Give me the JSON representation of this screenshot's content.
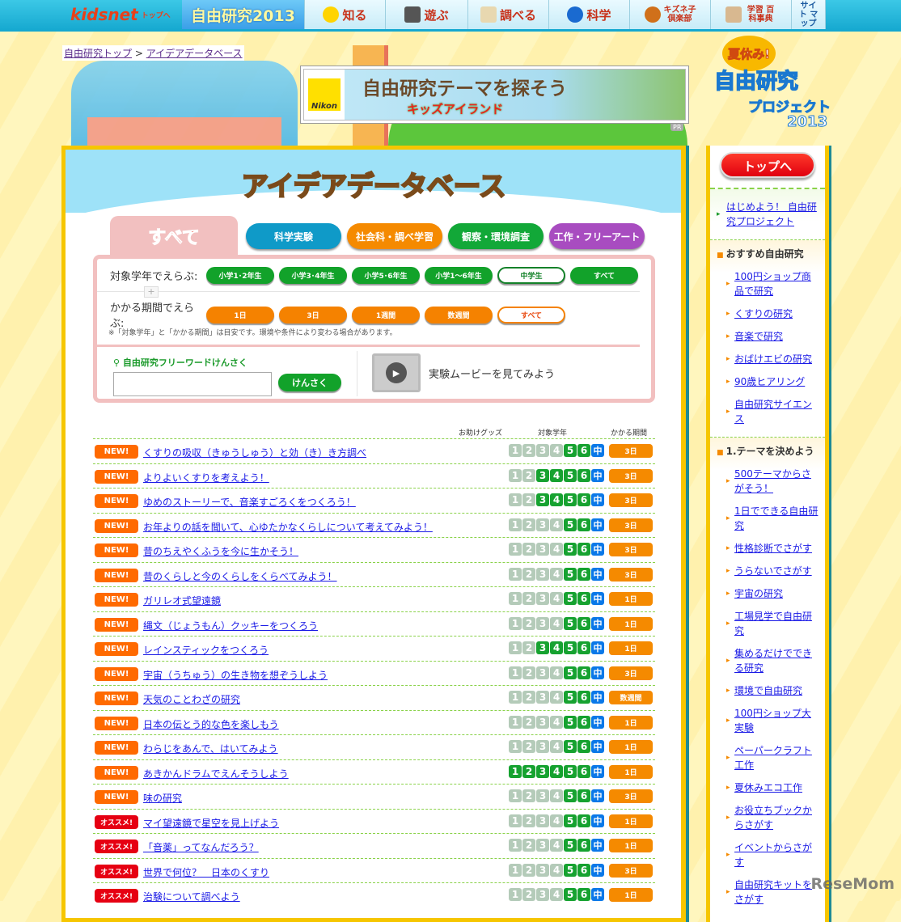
{
  "topnav": {
    "logo": "kidsnet",
    "logo_sub": "トップへ",
    "items": [
      {
        "label": "自由研究2013",
        "icon": "jiyu-kenkyu-logo"
      },
      {
        "label": "知る",
        "icon": "lightbulb-icon"
      },
      {
        "label": "遊ぶ",
        "icon": "dice-icon"
      },
      {
        "label": "調べる",
        "icon": "book-magnifier-icon"
      },
      {
        "label": "科学",
        "icon": "globe-icon"
      },
      {
        "label": "キズネ子 倶楽部",
        "icon": "fox-icon"
      },
      {
        "label": "学習 百科事典",
        "icon": "encyclopedia-icon"
      },
      {
        "label": "サイト マップ",
        "icon": ""
      }
    ]
  },
  "breadcrumb": {
    "home": "自由研究トップ",
    "sep": ">",
    "current": "アイデアデータベース"
  },
  "ad": {
    "brand": "Nikon",
    "headline": "自由研究テーマを探そう",
    "sub": "キッズアイランド",
    "pr": "PR"
  },
  "page_title": "アイデアデータベース",
  "tabs": [
    {
      "label": "すべて",
      "color": "#f2c0c0",
      "active": true
    },
    {
      "label": "科学実験",
      "color": "#0f9ac8"
    },
    {
      "label": "社会科・調べ学習",
      "color": "#f58a00"
    },
    {
      "label": "観察・環境調査",
      "color": "#12a838"
    },
    {
      "label": "工作・フリーアート",
      "color": "#a84cc0"
    }
  ],
  "filter": {
    "grade_label": "対象学年でえらぶ:",
    "grade_options": [
      "小学1･2年生",
      "小学3･4年生",
      "小学5･6年生",
      "小学1〜6年生",
      "中学生",
      "すべて"
    ],
    "grade_selected": "中学生",
    "period_label": "かかる期間でえらぶ:",
    "period_options": [
      "1日",
      "3日",
      "1週間",
      "数週間",
      "すべて"
    ],
    "period_selected": "すべて",
    "plus": "+",
    "note": "※「対象学年」と「かかる期間」は目安です。環境や条件により変わる場合があります。",
    "search_label": "自由研究フリーワードけんさく",
    "search_value": "",
    "search_button": "けんさく",
    "movie_label": "実験ムービーを見てみよう"
  },
  "list": {
    "headers": {
      "goods": "お助けグッズ",
      "grade": "対象学年",
      "period": "かかる期間"
    },
    "grade_labels": [
      "1",
      "2",
      "3",
      "4",
      "5",
      "6",
      "中"
    ],
    "rows": [
      {
        "badge": "NEW!",
        "type": "new",
        "title": "くすりの吸収（きゅうしゅう）と効（き）き方調べ",
        "grades": [
          5,
          6
        ],
        "period": "3日"
      },
      {
        "badge": "NEW!",
        "type": "new",
        "title": "よりよいくすりを考えよう！",
        "grades": [
          3,
          4,
          5,
          6
        ],
        "period": "3日"
      },
      {
        "badge": "NEW!",
        "type": "new",
        "title": "ゆめのストーリーで、音楽すごろくをつくろう！",
        "grades": [
          3,
          4,
          5,
          6
        ],
        "period": "3日"
      },
      {
        "badge": "NEW!",
        "type": "new",
        "title": "お年よりの話を聞いて、心ゆたかなくらしについて考えてみよう！",
        "grades": [
          5,
          6
        ],
        "period": "3日"
      },
      {
        "badge": "NEW!",
        "type": "new",
        "title": "昔のちえやくふうを今に生かそう！",
        "grades": [
          5,
          6
        ],
        "period": "3日"
      },
      {
        "badge": "NEW!",
        "type": "new",
        "title": "昔のくらしと今のくらしをくらべてみよう！",
        "grades": [
          5,
          6
        ],
        "period": "3日"
      },
      {
        "badge": "NEW!",
        "type": "new",
        "title": "ガリレオ式望遠鏡",
        "grades": [
          5,
          6
        ],
        "period": "1日"
      },
      {
        "badge": "NEW!",
        "type": "new",
        "title": "縄文（じょうもん）クッキーをつくろう",
        "grades": [
          5,
          6
        ],
        "period": "1日"
      },
      {
        "badge": "NEW!",
        "type": "new",
        "title": "レインスティックをつくろう",
        "grades": [
          3,
          4,
          5,
          6
        ],
        "period": "1日"
      },
      {
        "badge": "NEW!",
        "type": "new",
        "title": "宇宙（うちゅう）の生き物を想ぞうしよう",
        "grades": [
          5,
          6
        ],
        "period": "3日"
      },
      {
        "badge": "NEW!",
        "type": "new",
        "title": "天気のことわざの研究",
        "grades": [
          5,
          6
        ],
        "period": "数週間"
      },
      {
        "badge": "NEW!",
        "type": "new",
        "title": "日本の伝とう的な色を楽しもう",
        "grades": [
          5,
          6
        ],
        "period": "1日"
      },
      {
        "badge": "NEW!",
        "type": "new",
        "title": "わらじをあんで、はいてみよう",
        "grades": [
          5,
          6
        ],
        "period": "1日"
      },
      {
        "badge": "NEW!",
        "type": "new",
        "title": "あきかんドラムでえんそうしよう",
        "grades": [
          1,
          2,
          3,
          4,
          5,
          6
        ],
        "period": "1日"
      },
      {
        "badge": "NEW!",
        "type": "new",
        "title": "味の研究",
        "grades": [
          5,
          6
        ],
        "period": "3日"
      },
      {
        "badge": "オススメ!",
        "type": "rec",
        "title": "マイ望遠鏡で星空を見上げよう",
        "grades": [
          5,
          6
        ],
        "period": "1日"
      },
      {
        "badge": "オススメ!",
        "type": "rec",
        "title": "「音薬」ってなんだろう？",
        "grades": [
          5,
          6
        ],
        "period": "1日"
      },
      {
        "badge": "オススメ!",
        "type": "rec",
        "title": "世界で何位？　日本のくすり",
        "grades": [
          5,
          6
        ],
        "period": "3日"
      },
      {
        "badge": "オススメ!",
        "type": "rec",
        "title": "治験について調べよう",
        "grades": [
          5,
          6
        ],
        "period": "1日"
      }
    ]
  },
  "sidebar": {
    "natsu": "夏休み!",
    "project": "自由研究",
    "project2": "プロジェクト",
    "year": "2013",
    "top_button": "トップへ",
    "first_link": "はじめよう！ 自由研究プロジェクト",
    "groups": [
      {
        "title": "おすすめ自由研究",
        "links": [
          "100円ショップ商品で研究",
          "くすりの研究",
          "音楽で研究",
          "おばけエビの研究",
          "90歳ヒアリング",
          "自由研究サイエンス"
        ]
      },
      {
        "title": "1.テーマを決めよう",
        "links": [
          "500テーマからさがそう！",
          "1日でできる自由研究",
          "性格診断でさがす",
          "うらないでさがす",
          "宇宙の研究",
          "工場見学で自由研究",
          "集めるだけでできる研究",
          "環境で自由研究",
          "100円ショップ大実験",
          "ペーパークラフト工作",
          "夏休みエコ工作",
          "お役立ちブックからさがす",
          "イベントからさがす",
          "自由研究キットをさがす"
        ]
      }
    ]
  },
  "watermark": "ReseMom"
}
